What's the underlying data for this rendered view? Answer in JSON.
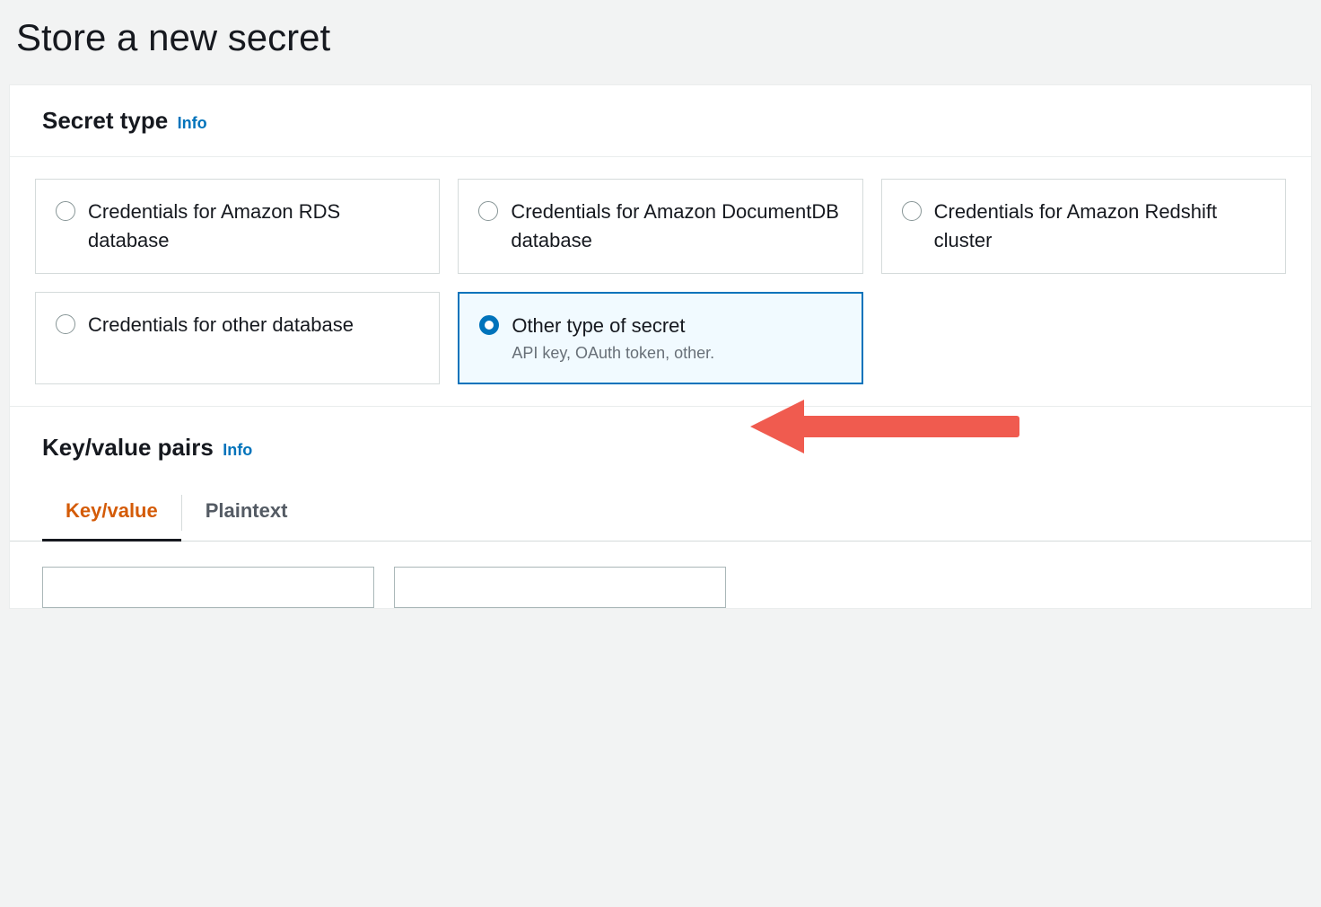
{
  "page": {
    "title": "Store a new secret"
  },
  "secretType": {
    "heading": "Secret type",
    "infoLabel": "Info",
    "options": [
      {
        "label": "Credentials for Amazon RDS database",
        "sublabel": "",
        "selected": false
      },
      {
        "label": "Credentials for Amazon DocumentDB database",
        "sublabel": "",
        "selected": false
      },
      {
        "label": "Credentials for Amazon Redshift cluster",
        "sublabel": "",
        "selected": false
      },
      {
        "label": "Credentials for other database",
        "sublabel": "",
        "selected": false
      },
      {
        "label": "Other type of secret",
        "sublabel": "API key, OAuth token, other.",
        "selected": true
      }
    ]
  },
  "kvPairs": {
    "heading": "Key/value pairs",
    "infoLabel": "Info",
    "tabs": {
      "keyValue": "Key/value",
      "plaintext": "Plaintext",
      "active": "keyValue"
    },
    "row": {
      "key": "",
      "value": ""
    }
  },
  "annotation": {
    "arrowColor": "#f05b4f"
  }
}
